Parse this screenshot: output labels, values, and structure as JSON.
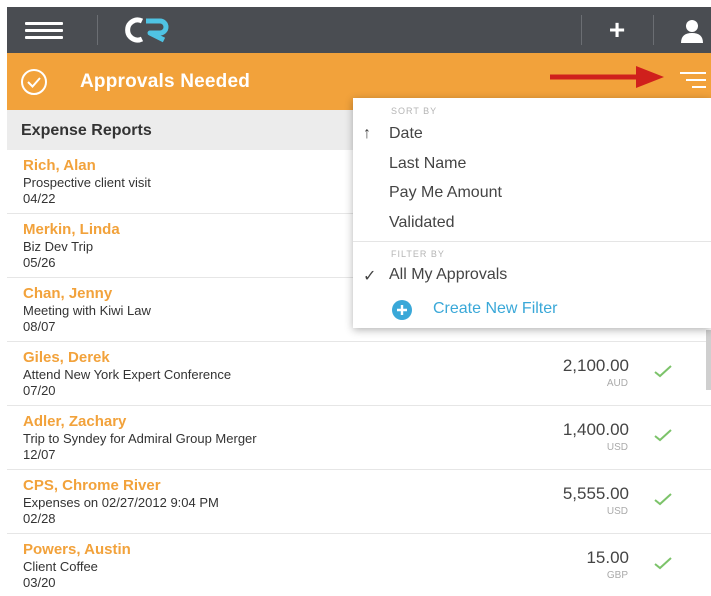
{
  "topbar": {
    "logo_text": "CR"
  },
  "subheader": {
    "title": "Approvals Needed"
  },
  "list": {
    "header": "Expense Reports",
    "rows": [
      {
        "name": "Rich, Alan",
        "desc": "Prospective client visit",
        "date": "04/22",
        "amount": "",
        "currency": "",
        "approved": false
      },
      {
        "name": "Merkin, Linda",
        "desc": "Biz Dev Trip",
        "date": "05/26",
        "amount": "",
        "currency": "",
        "approved": false
      },
      {
        "name": "Chan, Jenny",
        "desc": "Meeting with Kiwi Law",
        "date": "08/07",
        "amount": "",
        "currency": "",
        "approved": false
      },
      {
        "name": "Giles, Derek",
        "desc": "Attend New York Expert Conference",
        "date": "07/20",
        "amount": "2,100.00",
        "currency": "AUD",
        "approved": true
      },
      {
        "name": "Adler, Zachary",
        "desc": "Trip to Syndey for Admiral Group Merger",
        "date": "12/07",
        "amount": "1,400.00",
        "currency": "USD",
        "approved": true
      },
      {
        "name": "CPS, Chrome River",
        "desc": "Expenses on 02/27/2012 9:04 PM",
        "date": "02/28",
        "amount": "5,555.00",
        "currency": "USD",
        "approved": true
      },
      {
        "name": "Powers, Austin",
        "desc": "Client Coffee",
        "date": "03/20",
        "amount": "15.00",
        "currency": "GBP",
        "approved": true
      }
    ]
  },
  "dropdown": {
    "sort_label": "SORT BY",
    "sort_items": [
      "Date",
      "Last Name",
      "Pay Me Amount",
      "Validated"
    ],
    "filter_label": "FILTER BY",
    "filter_items": [
      "All My Approvals"
    ],
    "create_filter": "Create New Filter"
  },
  "colors": {
    "topbar": "#4a4d52",
    "accent_orange": "#f2a23b",
    "link_blue": "#3aa8d8",
    "check_green": "#7cc36a",
    "arrow_red": "#d0201c"
  }
}
